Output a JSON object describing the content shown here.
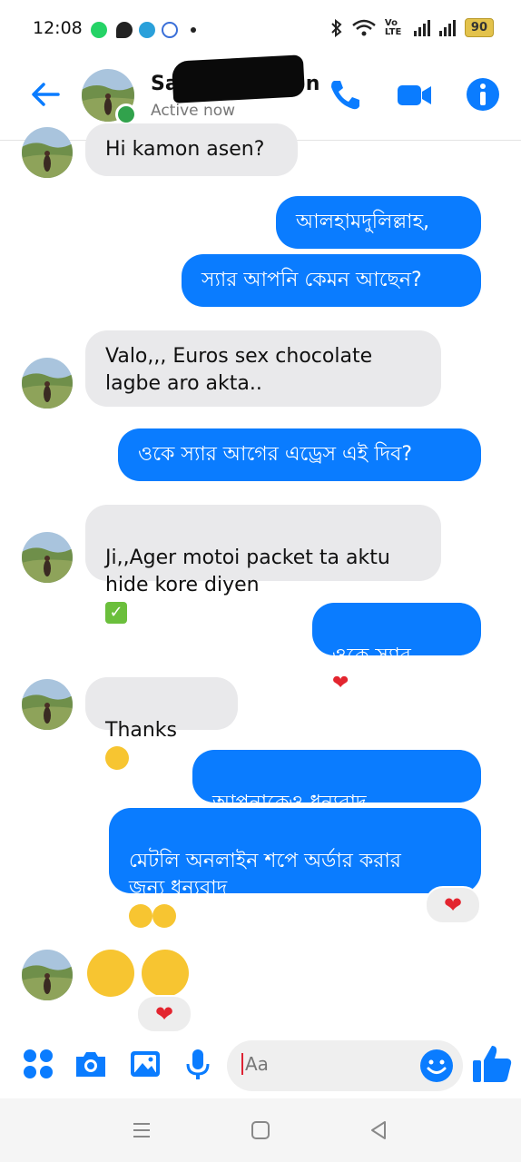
{
  "status": {
    "time": "12:08",
    "battery": "90",
    "volte": "Vo LTE"
  },
  "header": {
    "name": "Sa",
    "name_tail": "n",
    "status": "Active now"
  },
  "messages": [
    {
      "side": "in",
      "text": "Hi kamon asen?"
    },
    {
      "side": "out",
      "text": "আলহামদুলিল্লাহ,"
    },
    {
      "side": "out",
      "text": "স্যার আপনি কেমন আছেন?"
    },
    {
      "side": "in",
      "text": "Valo,,,  Euros sex chocolate\nlagbe aro akta.."
    },
    {
      "side": "out",
      "text": "ওকে স্যার আগের এড্রেস এই দিব?"
    },
    {
      "side": "in",
      "text": " Ji,,Ager motoi packet ta aktu\nhide kore diyen"
    },
    {
      "side": "out",
      "text": "ওকে স্যার"
    },
    {
      "side": "in",
      "text": "Thanks"
    },
    {
      "side": "out",
      "text": "আপনাকেও ধন্যবাদ"
    },
    {
      "side": "out",
      "text": "মেটলি অনলাইন শপে অর্ডার করার\nজন্য ধন্যবাদ"
    }
  ],
  "composer": {
    "placeholder": "Aa"
  },
  "colors": {
    "accent": "#0a7cff",
    "incoming": "#e9e9eb",
    "online": "#31a24c",
    "heart": "#e3252f"
  }
}
